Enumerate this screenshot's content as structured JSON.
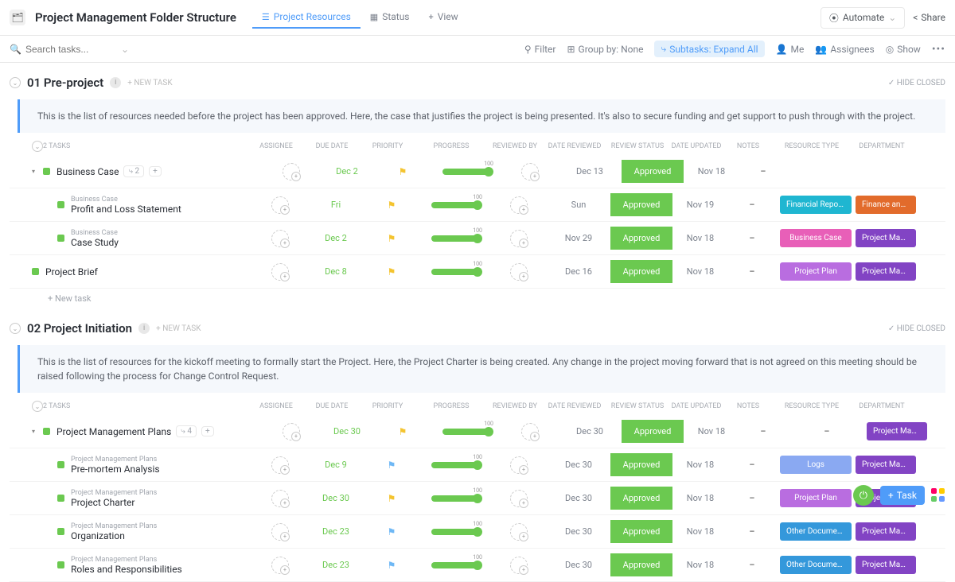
{
  "header": {
    "title": "Project Management Folder Structure",
    "tabs": [
      {
        "label": "Project Resources",
        "active": true
      },
      {
        "label": "Status",
        "active": false
      },
      {
        "label": "View",
        "active": false
      }
    ],
    "automate": "Automate",
    "share": "Share"
  },
  "filterBar": {
    "searchPlaceholder": "Search tasks...",
    "filter": "Filter",
    "groupBy": "Group by: None",
    "subtasks": "Subtasks: Expand All",
    "me": "Me",
    "assignees": "Assignees",
    "show": "Show"
  },
  "columns": {
    "assignee": "ASSIGNEE",
    "dueDate": "DUE DATE",
    "priority": "PRIORITY",
    "progress": "PROGRESS",
    "reviewedBy": "REVIEWED BY",
    "dateReviewed": "DATE REVIEWED",
    "reviewStatus": "REVIEW STATUS",
    "dateUpdated": "DATE UPDATED",
    "notes": "NOTES",
    "resourceType": "RESOURCE TYPE",
    "department": "DEPARTMENT"
  },
  "labels": {
    "newTask": "+ NEW TASK",
    "hideClosed": "HIDE CLOSED",
    "newTaskRow": "+ New task",
    "tasksCount2": "2 TASKS",
    "fabTask": "Task"
  },
  "colors": {
    "financialReports": "#1fb6d1",
    "businessCase": "#e85fb8",
    "projectPlan": "#b96de0",
    "logs": "#8aa9f2",
    "otherDocs": "#3498db",
    "finance": "#e26b2b",
    "pm": "#8244c4"
  },
  "groups": [
    {
      "name": "01 Pre-project",
      "description": "This is the list of resources needed before the project has been approved. Here, the case that justifies the project is being presented. It's also to secure funding and get support to push through with the project.",
      "tasks": [
        {
          "name": "Business Case",
          "parent": null,
          "subtaskCount": "2",
          "due": "Dec 2",
          "flag": "yellow",
          "dateReviewed": "Dec 13",
          "status": "Approved",
          "updated": "Nov 18",
          "notes": "–",
          "resourceType": null,
          "dept": null
        },
        {
          "name": "Profit and Loss Statement",
          "parent": "Business Case",
          "subtaskCount": null,
          "due": "Fri",
          "flag": "yellow",
          "dateReviewed": "Sun",
          "status": "Approved",
          "updated": "Nov 19",
          "notes": "–",
          "resourceType": {
            "label": "Financial Reports",
            "colorKey": "financialReports"
          },
          "dept": {
            "label": "Finance and Accou",
            "colorKey": "finance"
          }
        },
        {
          "name": "Case Study",
          "parent": "Business Case",
          "subtaskCount": null,
          "due": "Dec 2",
          "flag": "yellow",
          "dateReviewed": "Nov 29",
          "status": "Approved",
          "updated": "Nov 18",
          "notes": "–",
          "resourceType": {
            "label": "Business Case",
            "colorKey": "businessCase"
          },
          "dept": {
            "label": "Project Managem",
            "colorKey": "pm"
          }
        },
        {
          "name": "Project Brief",
          "parent": null,
          "subtaskCount": null,
          "due": "Dec 8",
          "flag": "yellow",
          "dateReviewed": "Dec 16",
          "status": "Approved",
          "updated": "Nov 18",
          "notes": "–",
          "resourceType": {
            "label": "Project Plan",
            "colorKey": "projectPlan"
          },
          "dept": {
            "label": "Project Managem",
            "colorKey": "pm"
          }
        }
      ]
    },
    {
      "name": "02 Project Initiation",
      "description": "This is the list of resources for the kickoff meeting to formally start the Project. Here, the Project Charter is being created. Any change in the project moving forward that is not agreed on this meeting should be raised following the process for Change Control Request.",
      "tasks": [
        {
          "name": "Project Management Plans",
          "parent": null,
          "subtaskCount": "4",
          "due": "Dec 30",
          "flag": "yellow",
          "dateReviewed": "Dec 30",
          "status": "Approved",
          "updated": "Nov 18",
          "notes": "–",
          "resourceType": {
            "label": "–",
            "plain": true
          },
          "dept": {
            "label": "Project Managem",
            "colorKey": "pm"
          }
        },
        {
          "name": "Pre-mortem Analysis",
          "parent": "Project Management Plans",
          "subtaskCount": null,
          "due": "Dec 9",
          "flag": "blue",
          "dateReviewed": "Dec 30",
          "status": "Approved",
          "updated": "Nov 18",
          "notes": "–",
          "resourceType": {
            "label": "Logs",
            "colorKey": "logs"
          },
          "dept": {
            "label": "Project Managem",
            "colorKey": "pm"
          }
        },
        {
          "name": "Project Charter",
          "parent": "Project Management Plans",
          "subtaskCount": null,
          "due": "Dec 30",
          "flag": "yellow",
          "dateReviewed": "Dec 30",
          "status": "Approved",
          "updated": "Nov 18",
          "notes": "–",
          "resourceType": {
            "label": "Project Plan",
            "colorKey": "projectPlan"
          },
          "dept": {
            "label": "Project Managem",
            "colorKey": "pm"
          }
        },
        {
          "name": "Organization",
          "parent": "Project Management Plans",
          "subtaskCount": null,
          "due": "Dec 23",
          "flag": "blue",
          "dateReviewed": "Dec 30",
          "status": "Approved",
          "updated": "Nov 18",
          "notes": "–",
          "resourceType": {
            "label": "Other Documents",
            "colorKey": "otherDocs"
          },
          "dept": {
            "label": "Project Managem",
            "colorKey": "pm"
          }
        },
        {
          "name": "Roles and Responsibilities",
          "parent": "Project Management Plans",
          "subtaskCount": null,
          "due": "Dec 23",
          "flag": "blue",
          "dateReviewed": "Dec 30",
          "status": "Approved",
          "updated": "Nov 18",
          "notes": "–",
          "resourceType": {
            "label": "Other Documents",
            "colorKey": "otherDocs"
          },
          "dept": {
            "label": "Project Managem",
            "colorKey": "pm"
          }
        }
      ]
    }
  ]
}
